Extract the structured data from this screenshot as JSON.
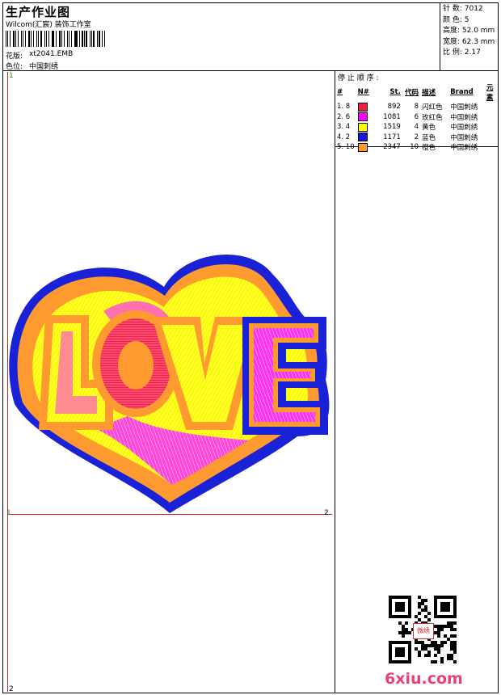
{
  "header": {
    "title": "生产作业图",
    "studio": "Wilcom(汇宸) 装饰工作室",
    "pattern_label": "花版:",
    "pattern_value": "xt2041.EMB",
    "colorway_label": "色位:",
    "colorway_value": "中国刺绣"
  },
  "stats": {
    "stitches": "针 数: 7012",
    "colors": "颜 色: 5",
    "height": "高度: 52.0 mm",
    "width": "宽度: 62.3 mm",
    "scale": "比 例: 2.17"
  },
  "stop_sequence": {
    "title": "停 止 顺 序 :",
    "headers": [
      "#",
      "N#",
      "St.",
      "代码",
      "描述",
      "Brand",
      "元素"
    ],
    "rows": [
      {
        "idx": "1. 8",
        "color": "#e8204a",
        "stitches": "892",
        "code": "8",
        "desc": "闪红色",
        "brand": "中国刺绣"
      },
      {
        "idx": "2. 6",
        "color": "#ff00ff",
        "stitches": "1081",
        "code": "6",
        "desc": "玫红色",
        "brand": "中国刺绣"
      },
      {
        "idx": "3. 4",
        "color": "#ffff00",
        "stitches": "1519",
        "code": "4",
        "desc": "黄色",
        "brand": "中国刺绣"
      },
      {
        "idx": "4. 2",
        "color": "#1818e0",
        "stitches": "1171",
        "code": "2",
        "desc": "蓝色",
        "brand": "中国刺绣"
      },
      {
        "idx": "5. 10",
        "color": "#ff9a30",
        "stitches": "2347",
        "code": "10",
        "desc": "橙色",
        "brand": "中国刺绣"
      }
    ]
  },
  "design": {
    "text": "LOVE"
  },
  "markers": {
    "top_left": "1",
    "mid_left": "1",
    "mid_right": "2",
    "bottom_left": "2"
  },
  "watermark": {
    "text": "6xiu.com",
    "qr_center": "微绣"
  }
}
